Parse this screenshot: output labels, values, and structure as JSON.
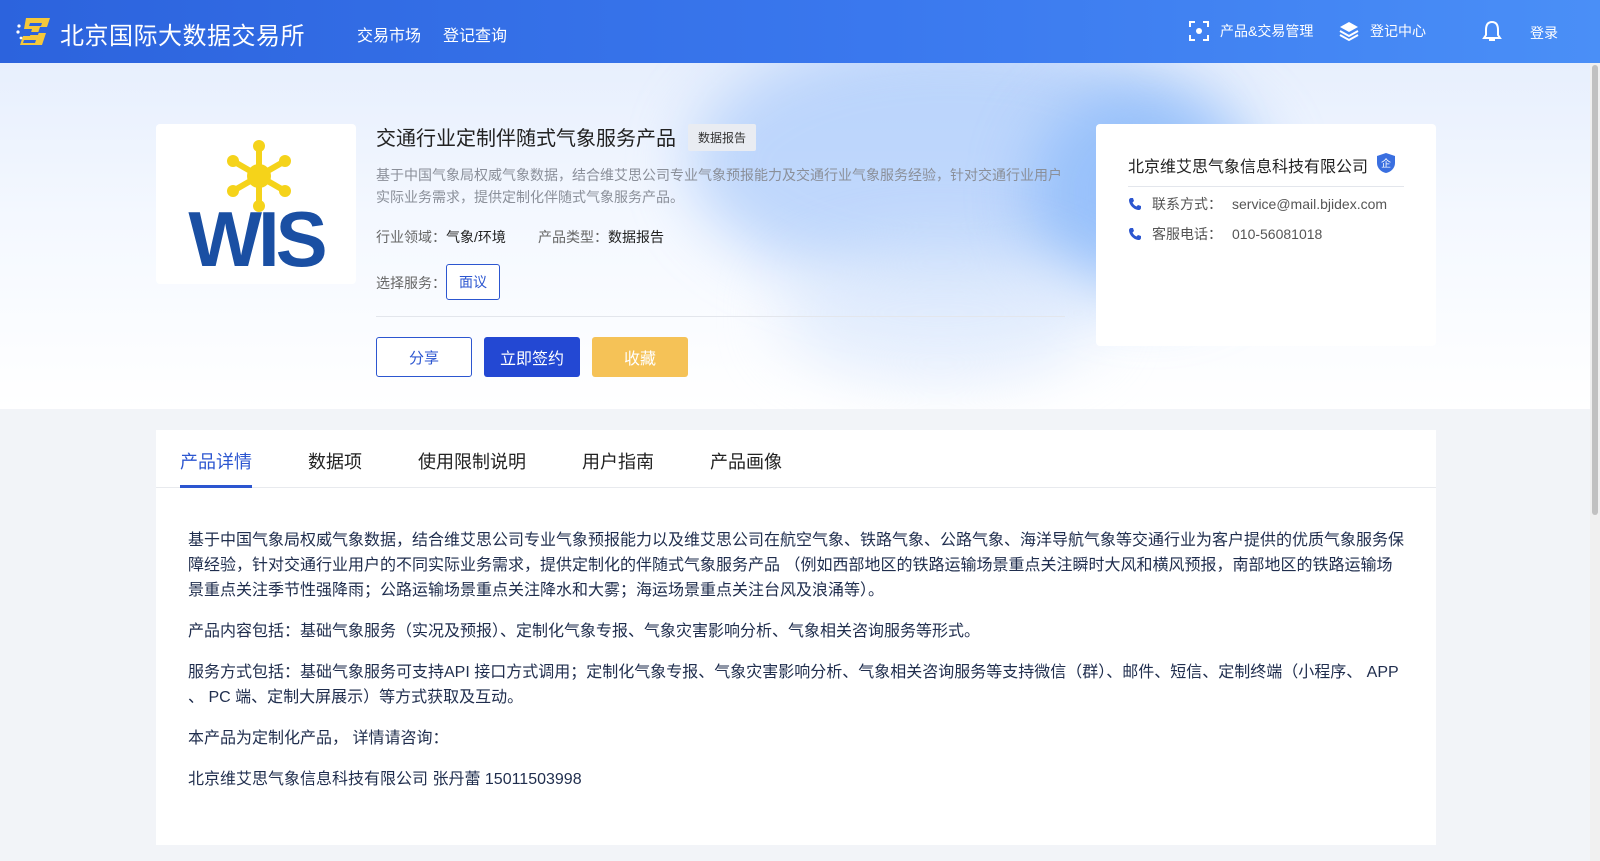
{
  "header": {
    "site_title": "北京国际大数据交易所",
    "nav": [
      "交易市场",
      "登记查询"
    ],
    "right": {
      "product_mgmt": "产品&交易管理",
      "registry_center": "登记中心",
      "login": "登录"
    }
  },
  "product": {
    "logo_text": "WIS",
    "title": "交通行业定制伴随式气象服务产品",
    "tag": "数据报告",
    "description": "基于中国气象局权威气象数据，结合维艾思公司专业气象预报能力及交通行业气象服务经验，针对交通行业用户实际业务需求，提供定制化伴随式气象服务产品。",
    "industry_label": "行业领域：",
    "industry_value": "气象/环境",
    "type_label": "产品类型：",
    "type_value": "数据报告",
    "service_label": "选择服务：",
    "service_option": "面议",
    "share_label": "分享",
    "sign_label": "立即签约",
    "favorite_label": "收藏"
  },
  "company": {
    "name": "北京维艾思气象信息科技有限公司",
    "enterprise_badge": "企",
    "contact_label": "联系方式：",
    "contact_value": "service@mail.bjidex.com",
    "phone_label": "客服电话：",
    "phone_value": "010-56081018"
  },
  "tabs": [
    {
      "label": "产品详情",
      "active": true
    },
    {
      "label": "数据项",
      "active": false
    },
    {
      "label": "使用限制说明",
      "active": false
    },
    {
      "label": "用户指南",
      "active": false
    },
    {
      "label": "产品画像",
      "active": false
    }
  ],
  "details": {
    "p1": "基于中国气象局权威气象数据，结合维艾思公司专业气象预报能力以及维艾思公司在航空气象、铁路气象、公路气象、海洋导航气象等交通行业为客户提供的优质气象服务保障经验，针对交通行业用户的不同实际业务需求，提供定制化的伴随式气象服务产品 （例如西部地区的铁路运输场景重点关注瞬时大风和横风预报，南部地区的铁路运输场景重点关注季节性强降雨；公路运输场景重点关注降水和大雾；海运场景重点关注台风及浪涌等）。",
    "p2": "产品内容包括：基础气象服务（实况及预报）、定制化气象专报、气象灾害影响分析、气象相关咨询服务等形式。",
    "p3": "服务方式包括：基础气象服务可支持API 接口方式调用；定制化气象专报、气象灾害影响分析、气象相关咨询服务等支持微信（群）、邮件、短信、定制终端（小程序、 APP 、 PC 端、定制大屏展示）等方式获取及互动。",
    "p4": "本产品为定制化产品， 详情请咨询：",
    "p5": "北京维艾思气象信息科技有限公司 张丹蕾 15011503998"
  },
  "colors": {
    "primary": "#2c56d0",
    "favorite": "#f5c257",
    "header_start": "#2c63dd",
    "header_end": "#4a8ff7"
  }
}
